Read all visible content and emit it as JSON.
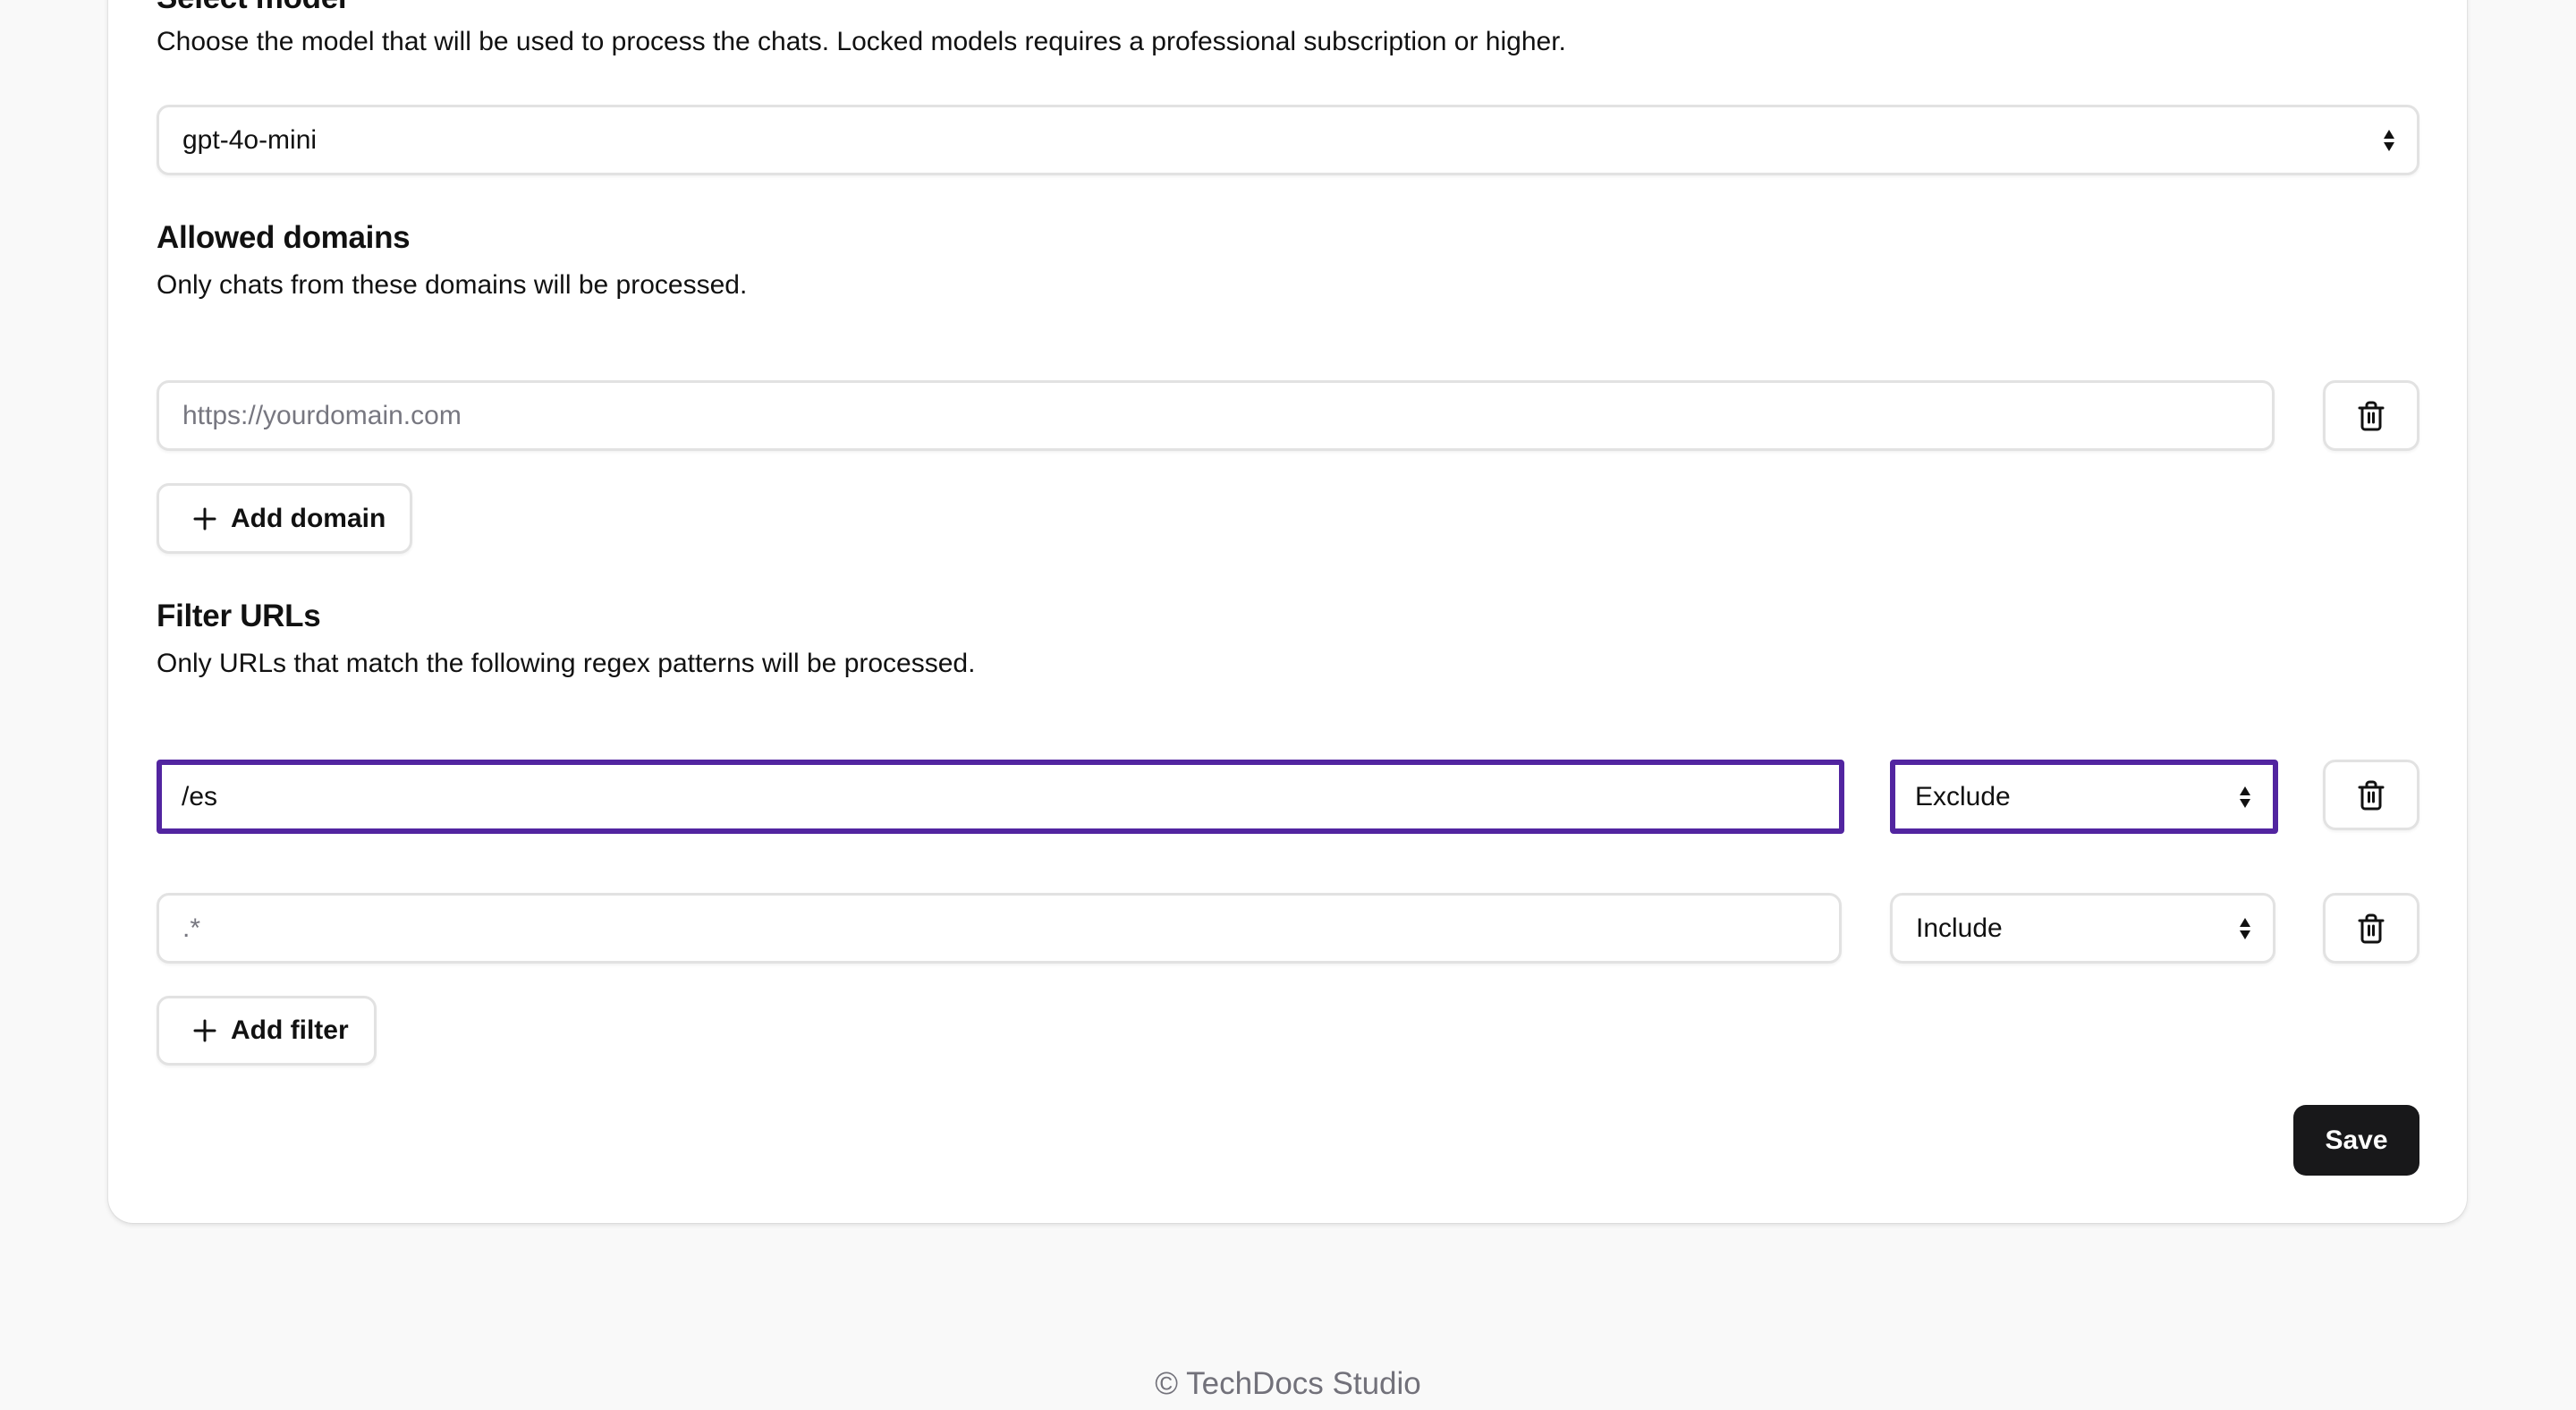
{
  "model_section": {
    "heading": "Select model",
    "description": "Choose the model that will be used to process the chats. Locked models requires a professional subscription or higher.",
    "selected_model": "gpt-4o-mini"
  },
  "domains_section": {
    "heading": "Allowed domains",
    "description": "Only chats from these domains will be processed.",
    "domains": [
      {
        "value": "",
        "placeholder": "https://yourdomain.com"
      }
    ],
    "add_label": "Add domain"
  },
  "filters_section": {
    "heading": "Filter URLs",
    "description": "Only URLs that match the following regex patterns will be processed.",
    "filters": [
      {
        "pattern": "/es",
        "placeholder": "",
        "mode": "Exclude",
        "focused": true
      },
      {
        "pattern": "",
        "placeholder": ".*",
        "mode": "Include",
        "focused": false
      }
    ],
    "add_label": "Add filter"
  },
  "actions": {
    "save_label": "Save"
  },
  "footer": {
    "text": "© TechDocs Studio"
  },
  "colors": {
    "focus": "#5225a0",
    "primary_button": "#18181a",
    "page_background": "#f9f9f9"
  }
}
